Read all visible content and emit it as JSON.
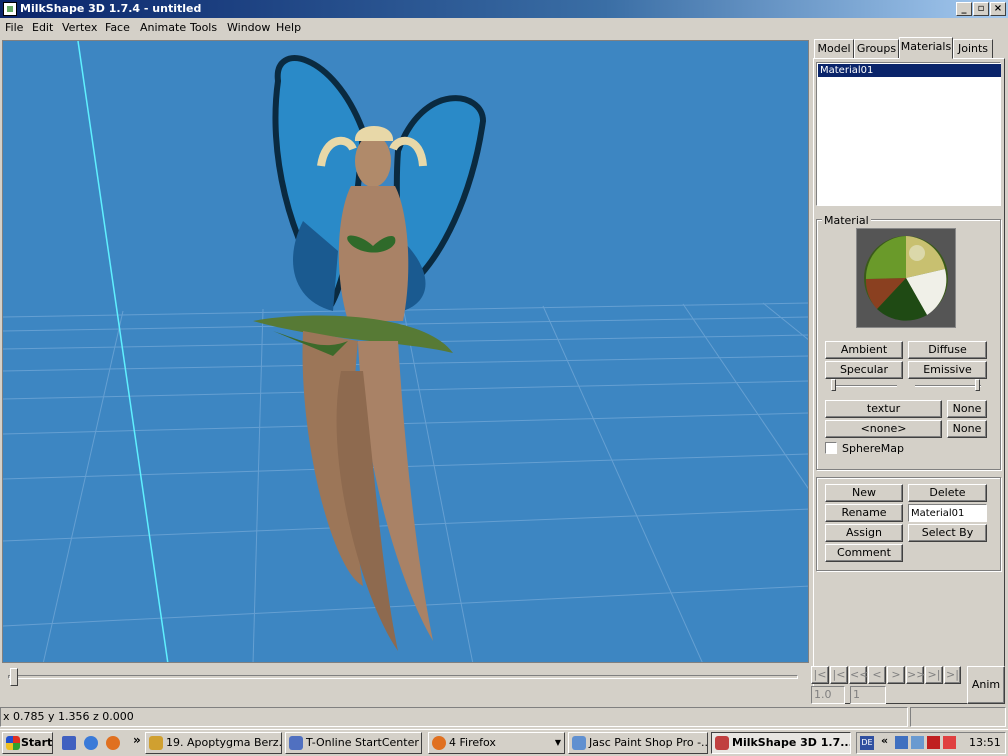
{
  "window": {
    "title": "MilkShape 3D 1.7.4 - untitled",
    "min": "_",
    "max": "▫",
    "close": "×"
  },
  "menu": [
    "File",
    "Edit",
    "Vertex",
    "Face",
    "Animate",
    "Tools",
    "Window",
    "Help"
  ],
  "tabs": [
    "Model",
    "Groups",
    "Materials",
    "Joints"
  ],
  "materials_list": [
    "Material01"
  ],
  "material_group": {
    "title": "Material",
    "ambient": "Ambient",
    "diffuse": "Diffuse",
    "specular": "Specular",
    "emissive": "Emissive",
    "texture": "textur",
    "texture_none": "None",
    "alpha": "<none>",
    "alpha_none": "None",
    "spheremap": "SphereMap"
  },
  "actions": {
    "new": "New",
    "delete": "Delete",
    "rename": "Rename",
    "rename_value": "Material01",
    "assign": "Assign",
    "select_by": "Select By",
    "comment": "Comment"
  },
  "anim": {
    "frame": "1.0",
    "total": "1",
    "button": "Anim",
    "controls": [
      "|<",
      "|<",
      "<<",
      "<",
      ">",
      ">>",
      ">|",
      ">|"
    ]
  },
  "status": {
    "coords": "x 0.785 y 1.356 z 0.000"
  },
  "taskbar": {
    "start": "Start",
    "chevron": "»",
    "tasks": [
      {
        "label": "19. Apoptygma Berz...",
        "color": "#d0a030"
      },
      {
        "label": "T-Online StartCenter",
        "color": "#5070c0"
      },
      {
        "label": "4 Firefox",
        "color": "#e07020"
      },
      {
        "label": "Jasc Paint Shop Pro -...",
        "color": "#6090d0"
      },
      {
        "label": "MilkShape 3D 1.7....",
        "color": "#c04040"
      }
    ],
    "tray_expand": "«",
    "clock": "13:51"
  }
}
